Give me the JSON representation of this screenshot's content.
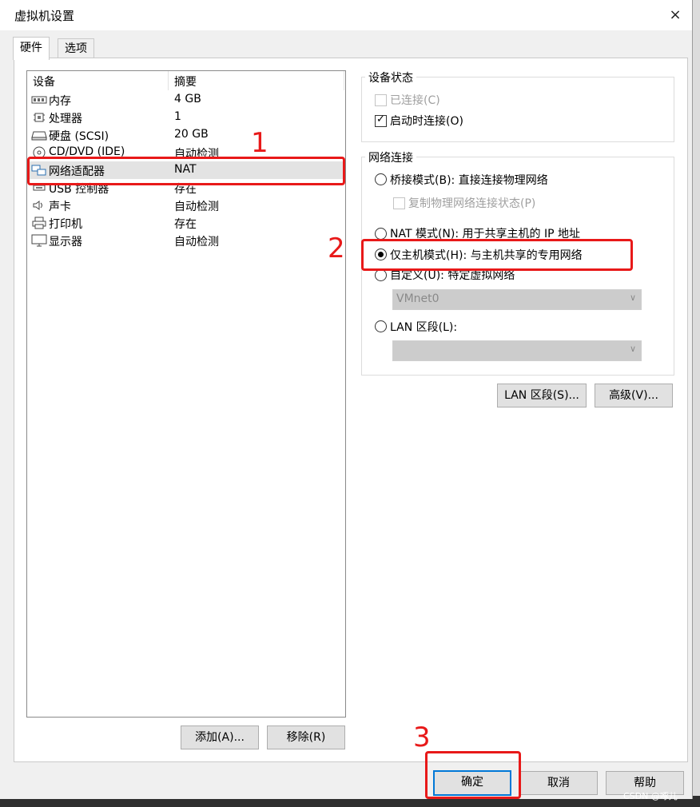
{
  "window": {
    "title": "虚拟机设置",
    "close_icon": "×"
  },
  "tabs": [
    {
      "label": "硬件"
    },
    {
      "label": "选项"
    }
  ],
  "device_list": {
    "headers": {
      "device": "设备",
      "summary": "摘要"
    },
    "rows": [
      {
        "icon": "memory-icon",
        "name": "内存",
        "summary": "4 GB"
      },
      {
        "icon": "processor-icon",
        "name": "处理器",
        "summary": "1"
      },
      {
        "icon": "hard-disk-icon",
        "name": "硬盘 (SCSI)",
        "summary": "20 GB"
      },
      {
        "icon": "cd-dvd-icon",
        "name": "CD/DVD (IDE)",
        "summary": "自动检测"
      },
      {
        "icon": "network-adapter-icon",
        "name": "网络适配器",
        "summary": "NAT",
        "selected": true
      },
      {
        "icon": "usb-icon",
        "name": "USB 控制器",
        "summary": "存在"
      },
      {
        "icon": "sound-card-icon",
        "name": "声卡",
        "summary": "自动检测"
      },
      {
        "icon": "printer-icon",
        "name": "打印机",
        "summary": "存在"
      },
      {
        "icon": "display-icon",
        "name": "显示器",
        "summary": "自动检测"
      }
    ],
    "add_button": "添加(A)...",
    "remove_button": "移除(R)"
  },
  "device_status": {
    "title": "设备状态",
    "connected": {
      "label": "已连接(C)",
      "checked": false,
      "enabled": false
    },
    "connect_at_power_on": {
      "label": "启动时连接(O)",
      "checked": true,
      "enabled": true
    }
  },
  "network_connection": {
    "title": "网络连接",
    "bridged": {
      "label": "桥接模式(B): 直接连接物理网络",
      "selected": false
    },
    "replicate_state": {
      "label": "复制物理网络连接状态(P)",
      "checked": false,
      "enabled": false
    },
    "nat": {
      "label": "NAT 模式(N): 用于共享主机的 IP 地址",
      "selected": false
    },
    "host_only": {
      "label": "仅主机模式(H): 与主机共享的专用网络",
      "selected": true
    },
    "custom": {
      "label": "自定义(U): 特定虚拟网络",
      "selected": false,
      "value": "VMnet0"
    },
    "lan_segment": {
      "label": "LAN 区段(L):",
      "selected": false,
      "value": ""
    }
  },
  "buttons": {
    "lan_segments": "LAN 区段(S)...",
    "advanced": "高级(V)...",
    "ok": "确定",
    "cancel": "取消",
    "help": "帮助"
  },
  "annotations": [
    "1",
    "2",
    "3"
  ],
  "watermark": "CSDN @啄儿",
  "colors": {
    "annotation_red": "#e81919",
    "focus_blue": "#0078d7",
    "selection_gray": "#e3e3e3"
  }
}
